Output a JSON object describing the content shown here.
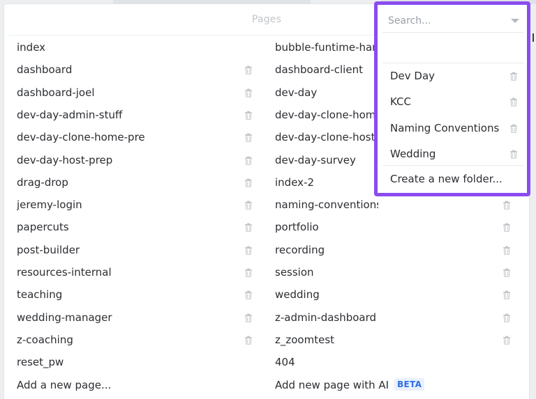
{
  "header": {
    "title": "Pages"
  },
  "pages_left": [
    {
      "name": "index",
      "deletable": false
    },
    {
      "name": "dashboard",
      "deletable": true
    },
    {
      "name": "dashboard-joel",
      "deletable": true
    },
    {
      "name": "dev-day-admin-stuff",
      "deletable": true
    },
    {
      "name": "dev-day-clone-home-pre",
      "deletable": true
    },
    {
      "name": "dev-day-host-prep",
      "deletable": true
    },
    {
      "name": "drag-drop",
      "deletable": true
    },
    {
      "name": "jeremy-login",
      "deletable": true
    },
    {
      "name": "papercuts",
      "deletable": true
    },
    {
      "name": "post-builder",
      "deletable": true
    },
    {
      "name": "resources-internal",
      "deletable": true
    },
    {
      "name": "teaching",
      "deletable": true
    },
    {
      "name": "wedding-manager",
      "deletable": true
    },
    {
      "name": "z-coaching",
      "deletable": true
    },
    {
      "name": "reset_pw",
      "deletable": false
    }
  ],
  "pages_right": [
    {
      "name": "bubble-funtime-hang",
      "deletable": false
    },
    {
      "name": "dashboard-client",
      "deletable": false
    },
    {
      "name": "dev-day",
      "deletable": false
    },
    {
      "name": "dev-day-clone-home",
      "deletable": false
    },
    {
      "name": "dev-day-clone-host-p",
      "deletable": false
    },
    {
      "name": "dev-day-survey",
      "deletable": false
    },
    {
      "name": "index-2",
      "deletable": false
    },
    {
      "name": "naming-conventions",
      "deletable": true
    },
    {
      "name": "portfolio",
      "deletable": true
    },
    {
      "name": "recording",
      "deletable": true
    },
    {
      "name": "session",
      "deletable": true
    },
    {
      "name": "wedding",
      "deletable": true
    },
    {
      "name": "z-admin-dashboard",
      "deletable": true
    },
    {
      "name": "z_zoomtest",
      "deletable": true
    },
    {
      "name": "404",
      "deletable": false
    }
  ],
  "actions": {
    "add_page": "Add a new page...",
    "add_page_ai": "Add new page with AI",
    "beta_badge": "BETA"
  },
  "folder_dropdown": {
    "search_placeholder": "Search...",
    "search_value": "",
    "folders": [
      "Dev Day",
      "KCC",
      "Naming Conventions",
      "Wedding"
    ],
    "create_label": "Create a new folder..."
  },
  "colors": {
    "dropdown_border": "#8b4cf0",
    "beta_text": "#2f6fe0",
    "beta_bg": "#eaf1fd",
    "icon_gray": "#c4c7cb"
  },
  "icons": {
    "delete": "trash-icon",
    "dropdown": "chevron-down-icon"
  }
}
